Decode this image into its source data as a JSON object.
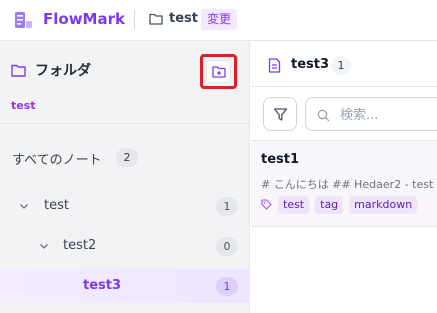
{
  "header": {
    "brand": "FlowMark",
    "folder_name": "test",
    "change_label": "変更"
  },
  "sidebar": {
    "title": "フォルダ",
    "breadcrumb": "test",
    "all_notes": {
      "label": "すべてのノート",
      "count": "2"
    },
    "tree": [
      {
        "label": "test",
        "count": "1",
        "expanded": true,
        "active": false
      },
      {
        "label": "test2",
        "count": "0",
        "expanded": true,
        "active": false
      },
      {
        "label": "test3",
        "count": "1",
        "expanded": false,
        "active": true
      }
    ]
  },
  "main": {
    "title": "test3",
    "count": "1",
    "search": {
      "placeholder": "検索...",
      "value": ""
    },
    "notes": [
      {
        "title": "test1",
        "preview": "# こんにちは ## Hedaer2 - test -",
        "tags": [
          "test",
          "tag",
          "markdown"
        ]
      }
    ]
  },
  "colors": {
    "accent": "#7c3aed",
    "highlight_border": "#e11d28",
    "sidebar_bg": "#f3f3f5",
    "active_row_bg": "#f3ebff"
  },
  "icons": {
    "logo": "flowmark-logo-icon",
    "folder": "folder-icon",
    "new_folder": "folder-plus-icon",
    "chevron": "chevron-down-icon",
    "note": "document-icon",
    "filter": "filter-icon",
    "search": "search-icon",
    "tag": "tag-icon"
  }
}
